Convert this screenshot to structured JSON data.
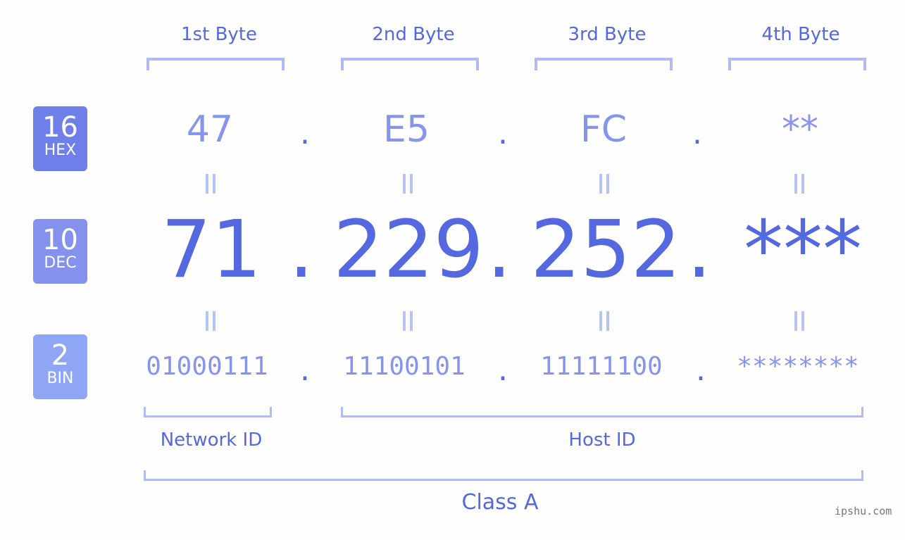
{
  "byte_headers": [
    "1st Byte",
    "2nd Byte",
    "3rd Byte",
    "4th Byte"
  ],
  "badges": [
    {
      "number": "16",
      "label": "HEX",
      "color": "#6f7fea"
    },
    {
      "number": "10",
      "label": "DEC",
      "color": "#8492ee"
    },
    {
      "number": "2",
      "label": "BIN",
      "color": "#8fa6f5"
    }
  ],
  "hex": [
    "47",
    "E5",
    "FC",
    "**"
  ],
  "dec": [
    "71",
    "229",
    "252",
    "***"
  ],
  "bin": [
    "01000111",
    "11100101",
    "11111100",
    "********"
  ],
  "separator": ".",
  "groups": {
    "network": "Network ID",
    "host": "Host ID",
    "class": "Class A"
  },
  "watermark": "ipshu.com"
}
